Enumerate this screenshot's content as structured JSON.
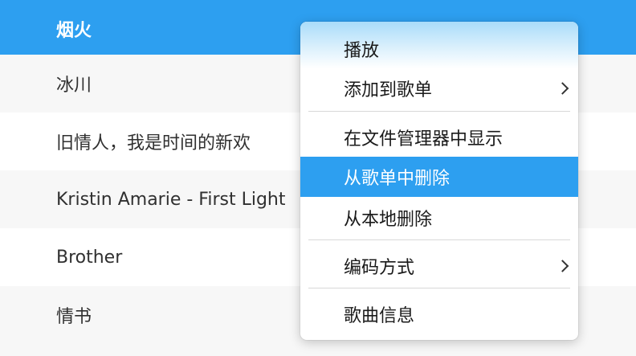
{
  "songs": [
    {
      "title": "烟火",
      "selected": true
    },
    {
      "title": "冰川"
    },
    {
      "title": "旧情人，我是时间的新欢"
    },
    {
      "title": "Kristin Amarie - First Light"
    },
    {
      "title": "Brother"
    },
    {
      "title": "情书"
    }
  ],
  "context_menu": {
    "play": "播放",
    "add_to_playlist": "添加到歌单",
    "show_in_file_manager": "在文件管理器中显示",
    "remove_from_playlist": "从歌单中删除",
    "delete_local": "从本地删除",
    "encoding": "编码方式",
    "song_info": "歌曲信息",
    "highlighted_item": "从歌单中删除",
    "submenu_icon": "chevron-right-icon"
  },
  "colors": {
    "accent": "#2d9ff0",
    "row_alt": "#f7f7f7",
    "text": "#303030"
  }
}
